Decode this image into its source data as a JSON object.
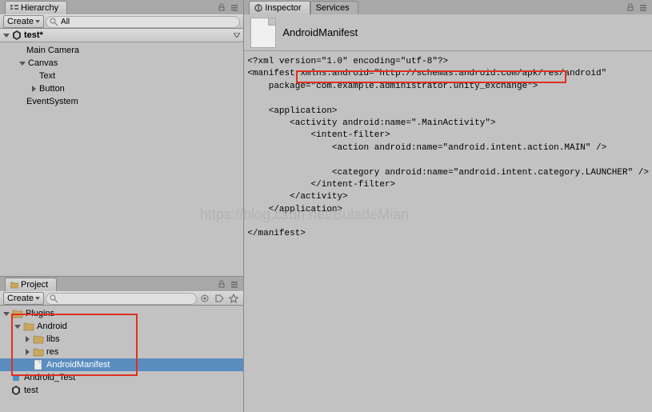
{
  "hierarchy": {
    "tab_label": "Hierarchy",
    "create_label": "Create",
    "search_filter": "All",
    "scene_name": "test*",
    "items": [
      "Main Camera",
      "Canvas",
      "Text",
      "Button",
      "EventSystem"
    ]
  },
  "project": {
    "tab_label": "Project",
    "create_label": "Create",
    "items": {
      "plugins": "Plugins",
      "android": "Android",
      "libs": "libs",
      "res": "res",
      "manifest": "AndroidManifest",
      "android_test": "Android_Test",
      "test": "test"
    }
  },
  "inspector": {
    "tab_label": "Inspector",
    "services_label": "Services",
    "asset_name": "AndroidManifest",
    "xml_content": "<?xml version=\"1.0\" encoding=\"utf-8\"?>\n<manifest xmlns:android=\"http://schemas.android.com/apk/res/android\"\n    package=\"com.example.administrator.unity_exchange\">\n\n    <application>\n        <activity android:name=\".MainActivity\">\n            <intent-filter>\n                <action android:name=\"android.intent.action.MAIN\" />\n\n                <category android:name=\"android.intent.category.LAUNCHER\" />\n            </intent-filter>\n        </activity>\n    </application>\n\n</manifest>"
  },
  "watermark": "https://blog.csdn.net/BuladeMian"
}
